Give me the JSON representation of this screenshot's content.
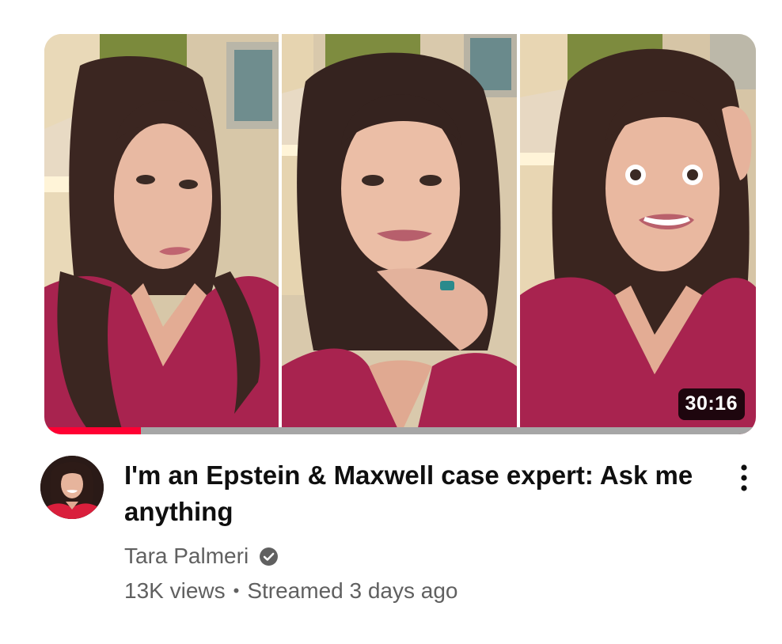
{
  "video": {
    "duration": "30:16",
    "watch_progress_fraction": 0.136,
    "title": "I'm an Epstein & Maxwell case expert: Ask me anything",
    "channel": "Tara Palmeri",
    "views": "13K views",
    "separator": "•",
    "streamed": "Streamed 3 days ago",
    "verified": true
  },
  "icons": {
    "verified": "verified-check-icon",
    "more": "more-vertical-icon"
  },
  "colors": {
    "progress": "#ff0033",
    "progress_track": "#a6a6a6",
    "shirt": "#a8234f",
    "secondary_text": "#606060"
  }
}
